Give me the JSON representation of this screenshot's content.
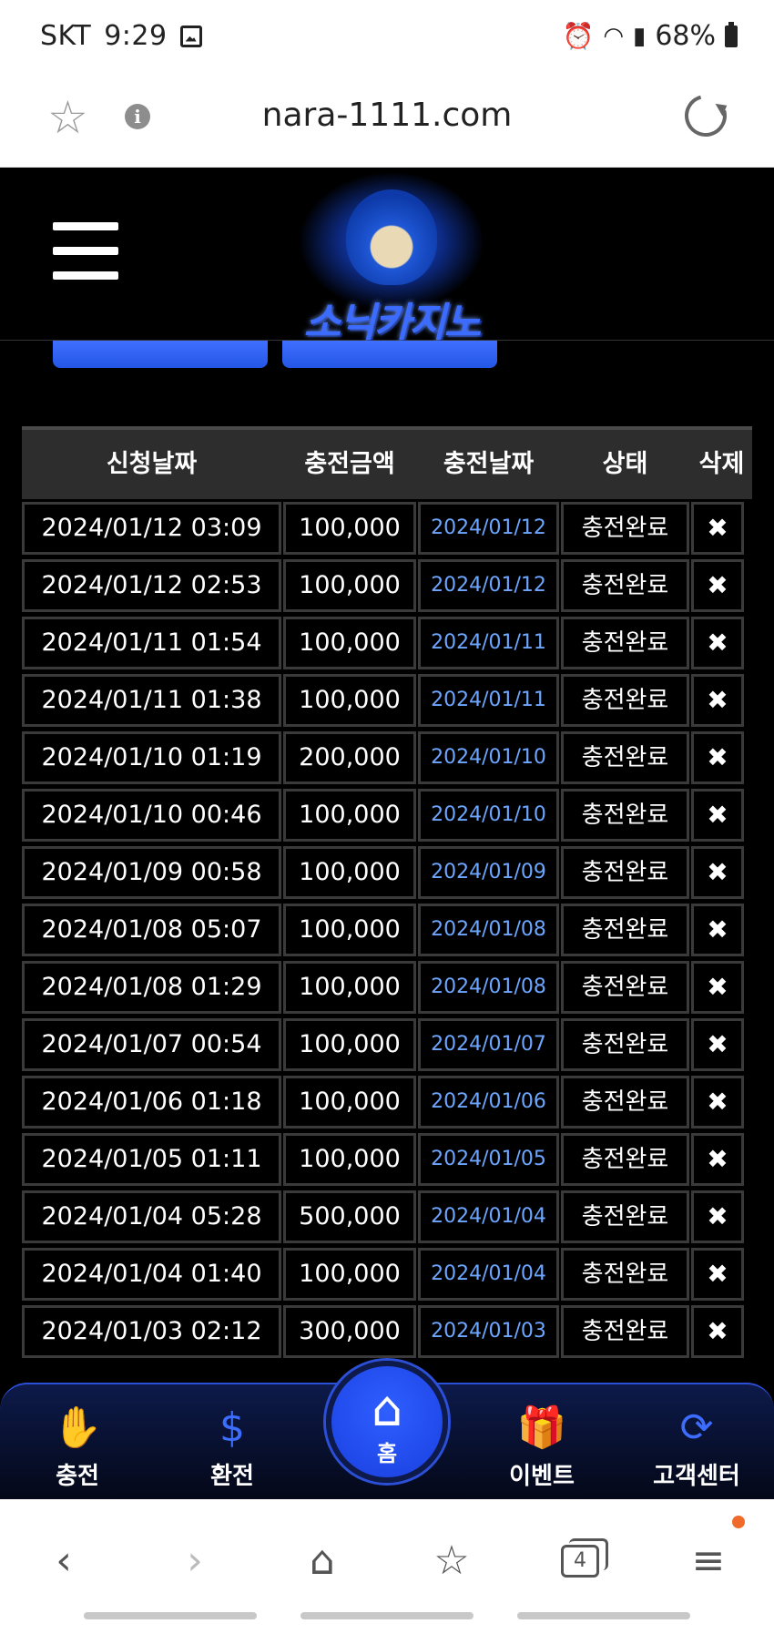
{
  "statusbar": {
    "carrier": "SKT",
    "time": "9:29",
    "battery": "68%"
  },
  "browser": {
    "url": "nara-1111.com",
    "tab_count": "4"
  },
  "site": {
    "logo_text": "소닉카지노"
  },
  "table": {
    "headers": [
      "신청날짜",
      "충전금액",
      "충전날짜",
      "상태",
      "삭제"
    ],
    "rows": [
      [
        "2024/01/12 03:09",
        "100,000",
        "2024/01/12",
        "충전완료",
        "✖"
      ],
      [
        "2024/01/12 02:53",
        "100,000",
        "2024/01/12",
        "충전완료",
        "✖"
      ],
      [
        "2024/01/11 01:54",
        "100,000",
        "2024/01/11",
        "충전완료",
        "✖"
      ],
      [
        "2024/01/11 01:38",
        "100,000",
        "2024/01/11",
        "충전완료",
        "✖"
      ],
      [
        "2024/01/10 01:19",
        "200,000",
        "2024/01/10",
        "충전완료",
        "✖"
      ],
      [
        "2024/01/10 00:46",
        "100,000",
        "2024/01/10",
        "충전완료",
        "✖"
      ],
      [
        "2024/01/09 00:58",
        "100,000",
        "2024/01/09",
        "충전완료",
        "✖"
      ],
      [
        "2024/01/08 05:07",
        "100,000",
        "2024/01/08",
        "충전완료",
        "✖"
      ],
      [
        "2024/01/08 01:29",
        "100,000",
        "2024/01/08",
        "충전완료",
        "✖"
      ],
      [
        "2024/01/07 00:54",
        "100,000",
        "2024/01/07",
        "충전완료",
        "✖"
      ],
      [
        "2024/01/06 01:18",
        "100,000",
        "2024/01/06",
        "충전완료",
        "✖"
      ],
      [
        "2024/01/05 01:11",
        "100,000",
        "2024/01/05",
        "충전완료",
        "✖"
      ],
      [
        "2024/01/04 05:28",
        "500,000",
        "2024/01/04",
        "충전완료",
        "✖"
      ],
      [
        "2024/01/04 01:40",
        "100,000",
        "2024/01/04",
        "충전완료",
        "✖"
      ],
      [
        "2024/01/03 02:12",
        "300,000",
        "2024/01/03",
        "충전완료",
        "✖"
      ]
    ]
  },
  "bottom_nav": {
    "charge": "충전",
    "exchange": "환전",
    "home": "홈",
    "event": "이벤트",
    "support": "고객센터"
  },
  "icons": {
    "charge": "hand-coin-icon",
    "exchange": "hands-dollar-icon",
    "home": "house-icon",
    "event": "gift-icon",
    "support": "24h-support-icon"
  },
  "colors": {
    "accent": "#2456e6",
    "link_date": "#6ca6ff",
    "header_bg": "#2d2d2d"
  }
}
